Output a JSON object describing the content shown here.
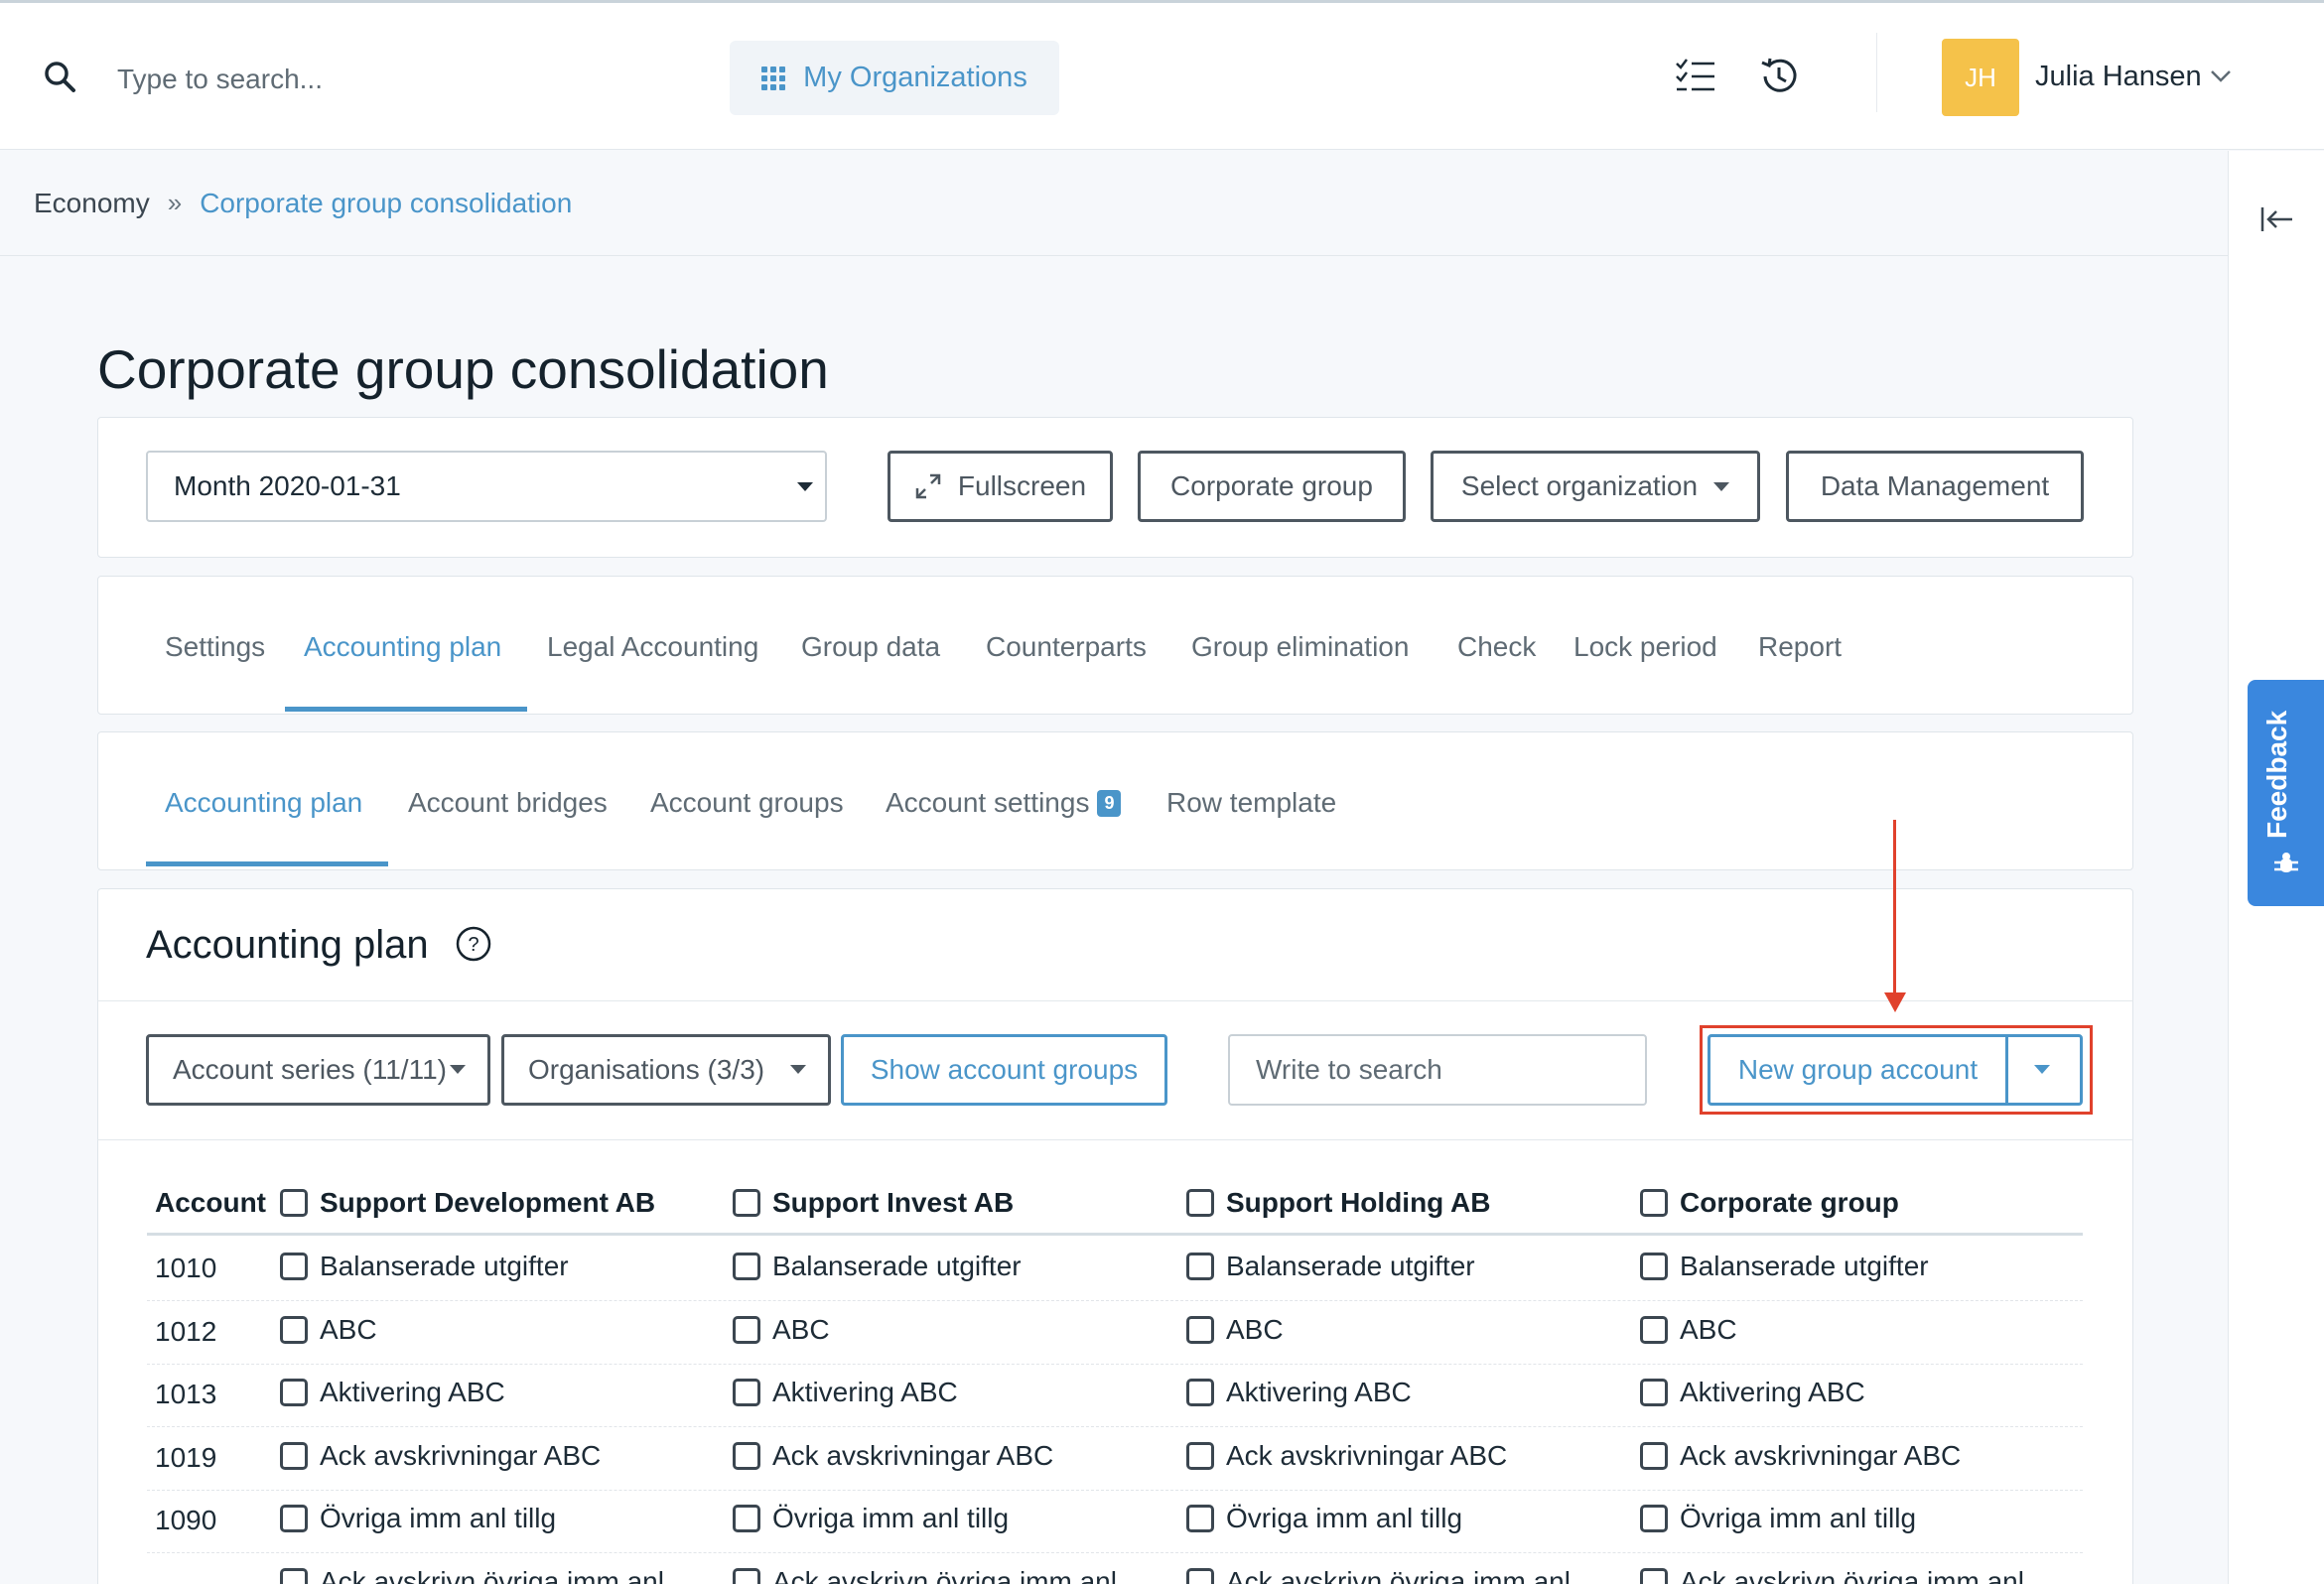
{
  "header": {
    "search_placeholder": "Type to search...",
    "my_organizations": "My Organizations",
    "user_initials": "JH",
    "user_name": "Julia Hansen",
    "icons": [
      "search-icon",
      "grid-icon",
      "checklist-icon",
      "history-icon",
      "chevron-down-icon"
    ]
  },
  "breadcrumb": {
    "root": "Economy",
    "separator": "»",
    "current": "Corporate group consolidation"
  },
  "page": {
    "title": "Corporate group consolidation"
  },
  "toolbar": {
    "period_value": "Month 2020-01-31",
    "fullscreen": "Fullscreen",
    "corporate_group": "Corporate group",
    "select_organization": "Select organization",
    "data_management": "Data Management"
  },
  "main_tabs": {
    "active_index": 1,
    "items": [
      "Settings",
      "Accounting plan",
      "Legal Accounting",
      "Group data",
      "Counterparts",
      "Group elimination",
      "Check",
      "Lock period",
      "Report"
    ]
  },
  "sub_tabs": {
    "active_index": 0,
    "items": [
      "Accounting plan",
      "Account bridges",
      "Account groups",
      "Account settings",
      "Row template"
    ],
    "account_settings_badge": "9"
  },
  "section": {
    "title": "Accounting plan",
    "filters": {
      "account_series": "Account series (11/11)",
      "organisations": "Organisations (3/3)",
      "show_account_groups": "Show account groups",
      "search_placeholder": "Write to search",
      "new_group_account": "New group account"
    }
  },
  "table": {
    "account_header": "Account",
    "columns": [
      "Support Development AB",
      "Support Invest AB",
      "Support Holding AB",
      "Corporate group"
    ],
    "rows": [
      {
        "account": "1010",
        "name": "Balanserade utgifter"
      },
      {
        "account": "1012",
        "name": "ABC"
      },
      {
        "account": "1013",
        "name": "Aktivering ABC"
      },
      {
        "account": "1019",
        "name": "Ack avskrivningar ABC"
      },
      {
        "account": "1090",
        "name": "Övriga imm anl tillg"
      },
      {
        "account": "",
        "name": "Ack avskrivn övriga imm anl"
      }
    ]
  },
  "feedback": {
    "label": "Feedback"
  },
  "annotation_color": "#e0412c",
  "accent_color": "#4a95c9"
}
